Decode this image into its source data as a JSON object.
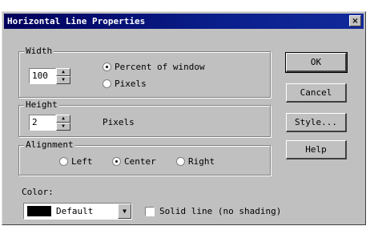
{
  "window": {
    "title": "Horizontal Line Properties",
    "close_symbol": "×"
  },
  "width": {
    "legend": "Width",
    "value": "100",
    "options": [
      {
        "label": "Percent of window",
        "selected": true
      },
      {
        "label": "Pixels",
        "selected": false
      }
    ]
  },
  "height": {
    "legend": "Height",
    "value": "2",
    "unit": "Pixels"
  },
  "alignment": {
    "legend": "Alignment",
    "options": [
      {
        "label": "Left",
        "selected": false
      },
      {
        "label": "Center",
        "selected": true
      },
      {
        "label": "Right",
        "selected": false
      }
    ]
  },
  "color": {
    "label": "Color:",
    "value": "Default",
    "swatch": "#000000"
  },
  "solid": {
    "label": "Solid line (no shading)",
    "checked": false
  },
  "buttons": {
    "ok": "OK",
    "cancel": "Cancel",
    "style": "Style...",
    "help": "Help"
  },
  "icons": {
    "up": "▲",
    "down": "▼"
  }
}
